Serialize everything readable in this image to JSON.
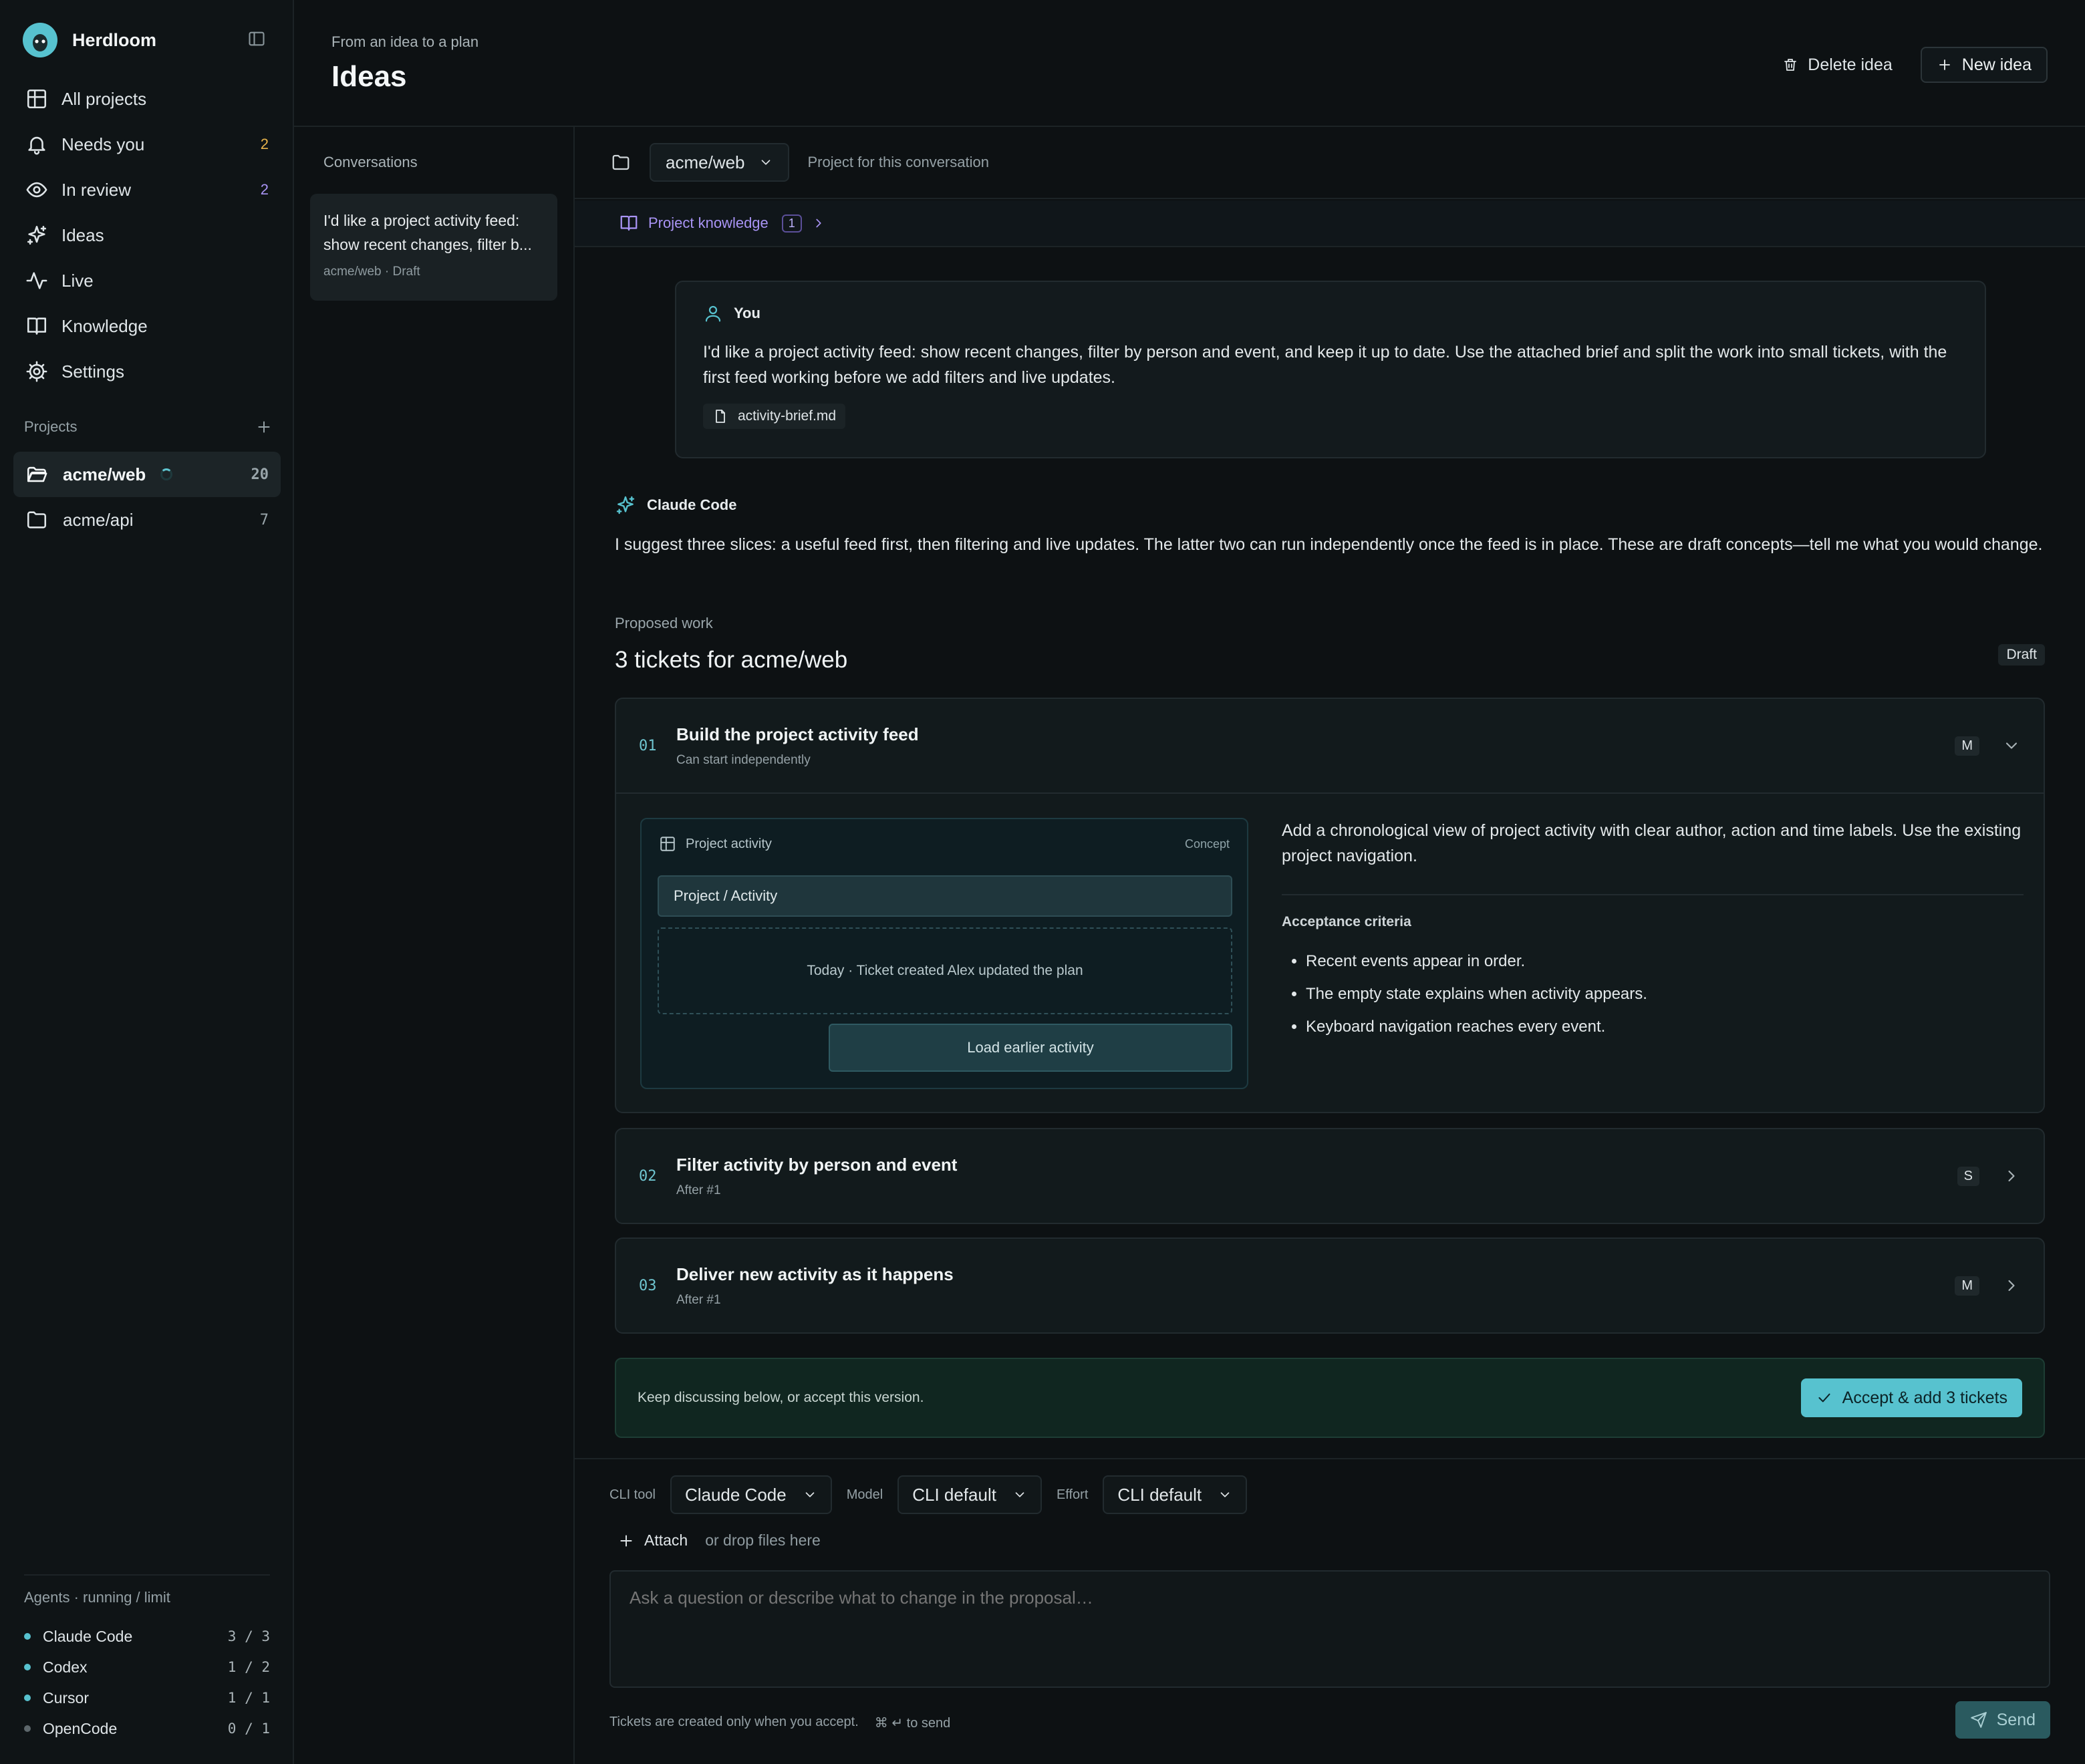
{
  "app": {
    "name": "Herdloom"
  },
  "sidebar": {
    "nav": [
      {
        "label": "All projects",
        "icon": "grid-icon",
        "count": ""
      },
      {
        "label": "Needs you",
        "icon": "bell-icon",
        "count": "2"
      },
      {
        "label": "In review",
        "icon": "eye-icon",
        "count": "2"
      },
      {
        "label": "Ideas",
        "icon": "sparkle-icon",
        "count": ""
      },
      {
        "label": "Live",
        "icon": "activity-icon",
        "count": ""
      },
      {
        "label": "Knowledge",
        "icon": "book-icon",
        "count": ""
      },
      {
        "label": "Settings",
        "icon": "gear-icon",
        "count": ""
      }
    ],
    "projects_header": "Projects",
    "projects": [
      {
        "name": "acme/web",
        "count": "20"
      },
      {
        "name": "acme/api",
        "count": "7"
      }
    ],
    "agents_header": "Agents · running / limit",
    "agents": [
      {
        "name": "Claude Code",
        "value": "3 / 3",
        "color": "#57c2cf"
      },
      {
        "name": "Codex",
        "value": "1 / 2",
        "color": "#57c2cf"
      },
      {
        "name": "Cursor",
        "value": "1 / 1",
        "color": "#57c2cf"
      },
      {
        "name": "OpenCode",
        "value": "0 / 1",
        "color": "#5d676b"
      }
    ]
  },
  "header": {
    "subtitle": "From an idea to a plan",
    "title": "Ideas",
    "delete_label": "Delete idea",
    "new_label": "New idea"
  },
  "conversations": {
    "header": "Conversations",
    "items": [
      {
        "title": "I'd like a project activity feed: show recent changes, filter b...",
        "meta": "acme/web · Draft"
      }
    ]
  },
  "main": {
    "project_select": "acme/web",
    "project_hint": "Project for this conversation",
    "knowledge_label": "Project knowledge",
    "knowledge_count": "1",
    "you_label": "You",
    "you_message": "I'd like a project activity feed: show recent changes, filter by person and event, and keep it up to date. Use the attached brief and split the work into small tickets, with the first feed working before we add filters and live updates.",
    "attachment": "activity-brief.md",
    "assistant_label": "Claude Code",
    "assistant_message": "I suggest three slices: a useful feed first, then filtering and live updates. The latter two can run independently once the feed is in place. These are draft concepts—tell me what you would change.",
    "proposed_label": "Proposed work",
    "tickets_title": "3 tickets for acme/web",
    "draft_badge": "Draft",
    "tickets": [
      {
        "num": "01",
        "title": "Build the project activity feed",
        "sub": "Can start independently",
        "size": "M"
      },
      {
        "num": "02",
        "title": "Filter activity by person and event",
        "sub": "After #1",
        "size": "S"
      },
      {
        "num": "03",
        "title": "Deliver new activity as it happens",
        "sub": "After #1",
        "size": "M"
      }
    ],
    "concept": {
      "title": "Project activity",
      "tag": "Concept",
      "breadcrumb": "Project / Activity",
      "sample": "Today · Ticket created Alex updated the plan",
      "button": "Load earlier activity"
    },
    "ticket1_desc": "Add a chronological view of project activity with clear author, action and time labels. Use the existing project navigation.",
    "acceptance_header": "Acceptance criteria",
    "acceptance": [
      "Recent events appear in order.",
      "The empty state explains when activity appears.",
      "Keyboard navigation reaches every event."
    ],
    "accept_bar_text": "Keep discussing below, or accept this version.",
    "accept_button": "Accept & add 3 tickets"
  },
  "composer": {
    "cli_label": "CLI tool",
    "cli_value": "Claude Code",
    "model_label": "Model",
    "model_value": "CLI default",
    "effort_label": "Effort",
    "effort_value": "CLI default",
    "attach_label": "Attach",
    "drop_hint": "or drop files here",
    "placeholder": "Ask a question or describe what to change in the proposal…",
    "footer_note": "Tickets are created only when you accept.",
    "shortcut": "⌘ ↵ to send",
    "send_label": "Send"
  }
}
